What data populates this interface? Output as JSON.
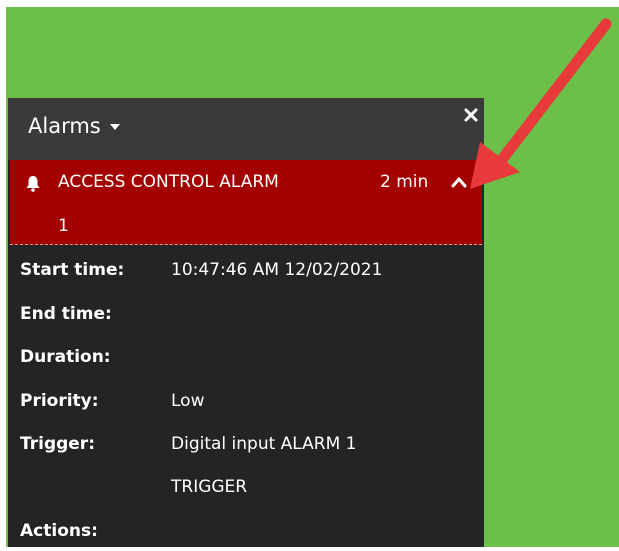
{
  "panel": {
    "title": "Alarms",
    "alarm": {
      "name": "ACCESS CONTROL ALARM",
      "id": "1",
      "elapsed": "2 min"
    },
    "details": [
      {
        "label": "Start time:",
        "value": "10:47:46 AM 12/02/2021"
      },
      {
        "label": "End time:",
        "value": ""
      },
      {
        "label": "Duration:",
        "value": ""
      },
      {
        "label": "Priority:",
        "value": "Low"
      },
      {
        "label": "Trigger:",
        "value": "Digital input ALARM 1"
      },
      {
        "label": "",
        "value": "TRIGGER"
      },
      {
        "label": "Actions:",
        "value": ""
      }
    ]
  },
  "colors": {
    "background": "#6cc04a",
    "panel": "#242424",
    "panel_header": "#3a3a3a",
    "alarm_header": "#a30000",
    "annotation_arrow": "#e83a3a"
  }
}
